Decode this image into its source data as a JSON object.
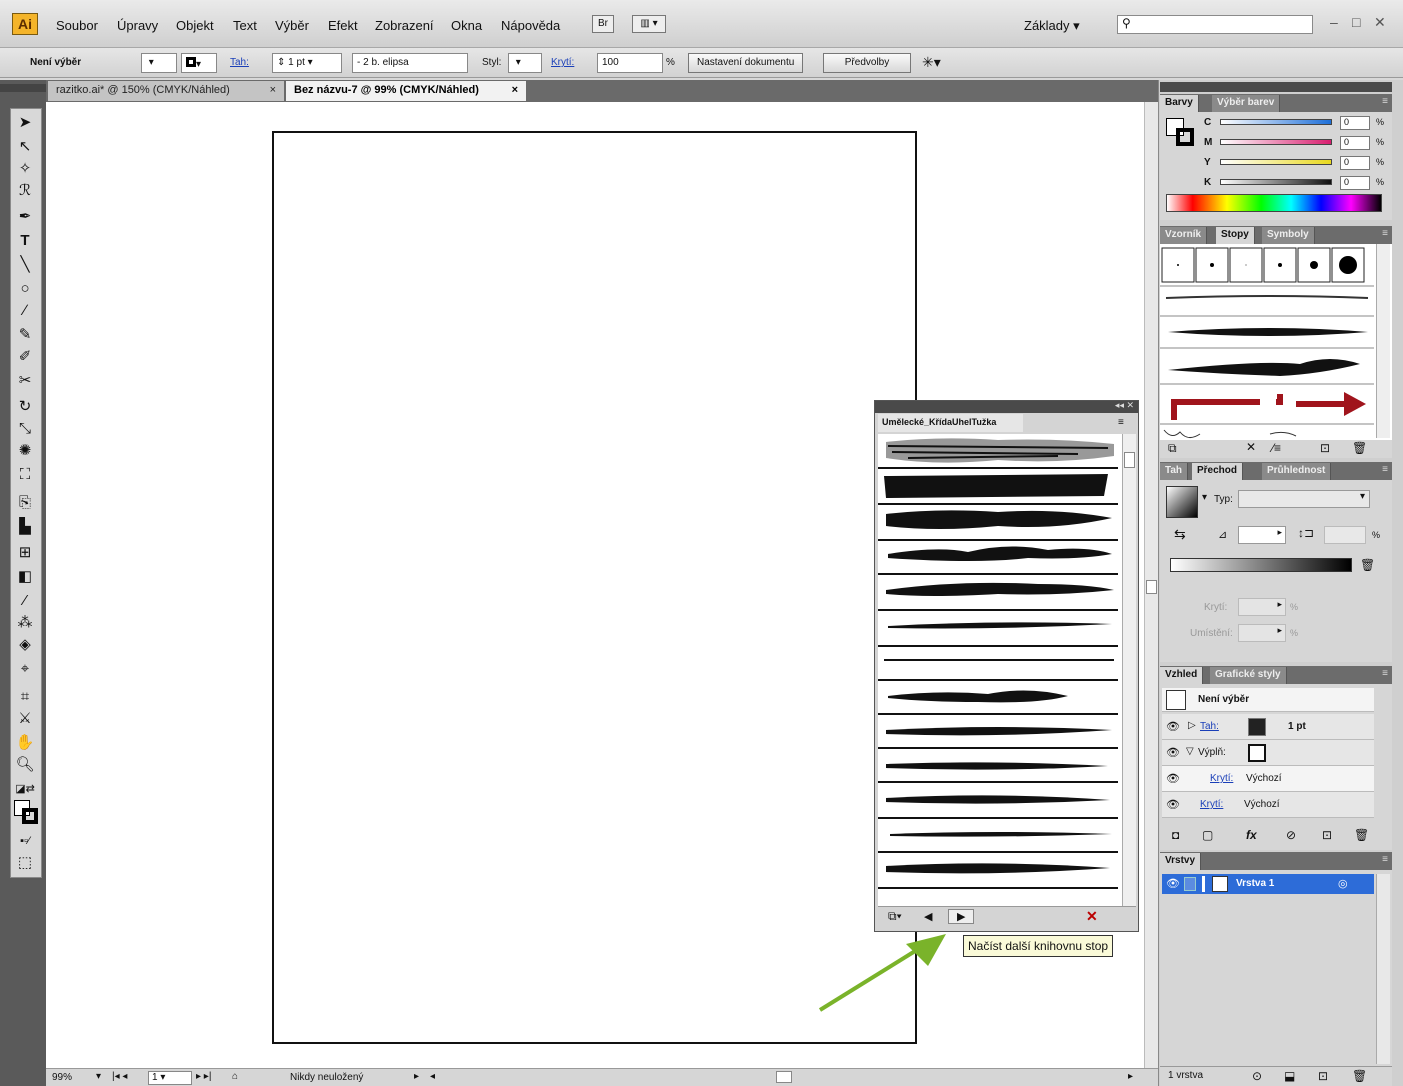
{
  "app": {
    "logo": "Ai"
  },
  "menu": [
    "Soubor",
    "Úpravy",
    "Objekt",
    "Text",
    "Výběr",
    "Efekt",
    "Zobrazení",
    "Okna",
    "Nápověda"
  ],
  "toolbar_top": {
    "bridge_label": "Br",
    "workspace": "Základy",
    "search_value": ""
  },
  "window_controls": {
    "minimize": "–",
    "restore": "□",
    "close": "✕"
  },
  "control_bar": {
    "selection": "Není výběr",
    "stroke_link": "Tah:",
    "stroke_weight": "1 pt",
    "brush": "2 b. elipsa",
    "style_label": "Styl:",
    "opacity_link": "Krytí:",
    "opacity_value": "100",
    "opacity_unit": "%",
    "doc_settings": "Nastavení dokumentu",
    "preferences": "Předvolby"
  },
  "document_tabs": [
    {
      "label": "razitko.ai* @ 150% (CMYK/Náhled)",
      "close": "×"
    },
    {
      "label": "Bez názvu-7 @ 99% (CMYK/Náhled)",
      "close": "×"
    }
  ],
  "status_bar": {
    "zoom": "99%",
    "page": "1",
    "status": "Nikdy neuložený"
  },
  "panels": {
    "color": {
      "tabs": [
        "Barvy",
        "Výběr barev"
      ],
      "channels": [
        {
          "label": "C",
          "value": "0",
          "unit": "%",
          "color": "#1e6fd8"
        },
        {
          "label": "M",
          "value": "0",
          "unit": "%",
          "color": "#d81e6f"
        },
        {
          "label": "Y",
          "value": "0",
          "unit": "%",
          "color": "#e8d81e"
        },
        {
          "label": "K",
          "value": "0",
          "unit": "%",
          "color": "#111111"
        }
      ]
    },
    "swatch_brush_symbol": {
      "tabs": [
        "Vzorník",
        "Stopy",
        "Symboly"
      ]
    },
    "stroke_gradient_transparency": {
      "tabs": [
        "Tah",
        "Přechod",
        "Průhlednost"
      ],
      "type_label": "Typ:",
      "opacity_label": "Krytí:",
      "location_label": "Umístění:",
      "percent": "%"
    },
    "appearance": {
      "tabs": [
        "Vzhled",
        "Grafické styly"
      ],
      "header": "Není výběr",
      "rows": [
        {
          "label": "Tah:",
          "value": "1 pt"
        },
        {
          "label": "Výplň:",
          "value": ""
        },
        {
          "label": "Krytí:",
          "value": "Výchozí"
        },
        {
          "label": "Krytí:",
          "value": "Výchozí"
        }
      ]
    },
    "layers": {
      "tabs": [
        "Vrstvy"
      ],
      "layer_name": "Vrstva 1",
      "footer": "1 vrstva"
    }
  },
  "brush_library": {
    "title": "Umělecké_KřídaUhelTužka",
    "tooltip": "Načíst další knihovnu stop"
  }
}
